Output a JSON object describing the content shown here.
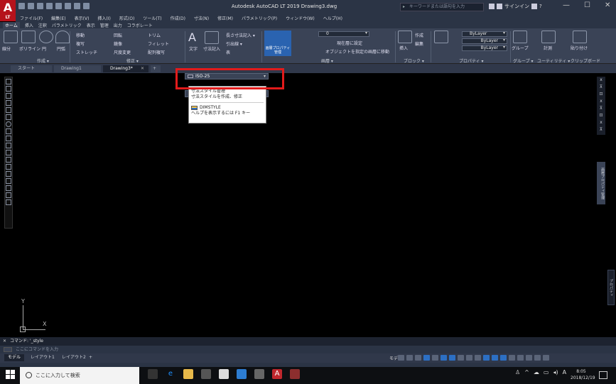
{
  "app": {
    "logo_letter": "A",
    "logo_sub": "LT",
    "title": "Autodesk AutoCAD LT 2019    Drawing3.dwg",
    "search_placeholder": "キーワードまたは語句を入力",
    "signin": "サインイン",
    "window_controls": [
      "—",
      "☐",
      "✕"
    ]
  },
  "menu": [
    "ファイル(F)",
    "編集(E)",
    "表示(V)",
    "挿入(I)",
    "形式(O)",
    "ツール(T)",
    "作成(D)",
    "寸法(N)",
    "修正(M)",
    "パラメトリック(P)",
    "ウィンドウ(W)",
    "ヘルプ(H)"
  ],
  "ribbon_tabs": [
    "ホーム",
    "挿入",
    "注釈",
    "パラメトリック",
    "表示",
    "管理",
    "出力",
    "コラボレート"
  ],
  "ribbon": {
    "draw": {
      "title": "作成 ▾",
      "line": "線分",
      "polyline": "ポリライン",
      "circle": "円",
      "arc": "円弧"
    },
    "modify": {
      "title": "修正 ▾",
      "row1": [
        "移動",
        "回転",
        "トリム"
      ],
      "row2": [
        "複写",
        "鏡像",
        "フィレット"
      ],
      "row3": [
        "ストレッチ",
        "尺度変更",
        "配列複写"
      ]
    },
    "annotation": {
      "text": "文字",
      "dimension": "寸法記入",
      "linear": "長さ寸法記入 ▾",
      "leader": "引出線 ▾",
      "table": "表"
    },
    "layers": {
      "title": "画層 ▾",
      "props_btn": "画層プロパティ管理",
      "layer_value": "0",
      "set_current": "現在層に設定",
      "move_to_layer": "オブジェクトを指定の画層に移動"
    },
    "block": {
      "title": "ブロック ▾",
      "insert": "挿入",
      "create": "作成",
      "edit": "編集"
    },
    "properties": {
      "title": "プロパティ ▾",
      "match": "プロパティ\nコピー",
      "bylayer": [
        "ByLayer",
        "ByLayer",
        "ByLayer"
      ]
    },
    "groups": {
      "title": "グループ ▾",
      "group": "グループ"
    },
    "utilities": {
      "title": "ユーティリティ ▾",
      "measure": "計測"
    },
    "clipboard": {
      "title": "クリップボード",
      "paste": "貼り付け"
    }
  },
  "file_tabs": [
    "スタート",
    "Drawing1",
    "Drawing3*"
  ],
  "dropdown": {
    "dim_style": "ISO-25",
    "tooltip_line1": "寸法スタイル管理",
    "tooltip_line2": "寸法スタイルを作成、修正",
    "command": "DIMSTYLE",
    "help": "ヘルプを表示するには F1 キー"
  },
  "ucs": {
    "x": "X",
    "y": "Y"
  },
  "right_panel": {
    "nav": [
      "x",
      "⊼",
      "⊡",
      "x",
      "⊼",
      "⊡",
      "x",
      "⊼"
    ],
    "props": "画層プロパティ管理",
    "props2": "プロパティ"
  },
  "command_line": {
    "history": "コマンド: '_style",
    "placeholder": "ここにコマンドを入力"
  },
  "layout_tabs": [
    "モデル",
    "レイアウト1",
    "レイアウト2",
    "+"
  ],
  "status": {
    "model": "モデル"
  },
  "taskbar": {
    "search": "ここに入力して検索",
    "clock_time": "8:05",
    "clock_date": "2018/12/19",
    "ime": "A"
  }
}
